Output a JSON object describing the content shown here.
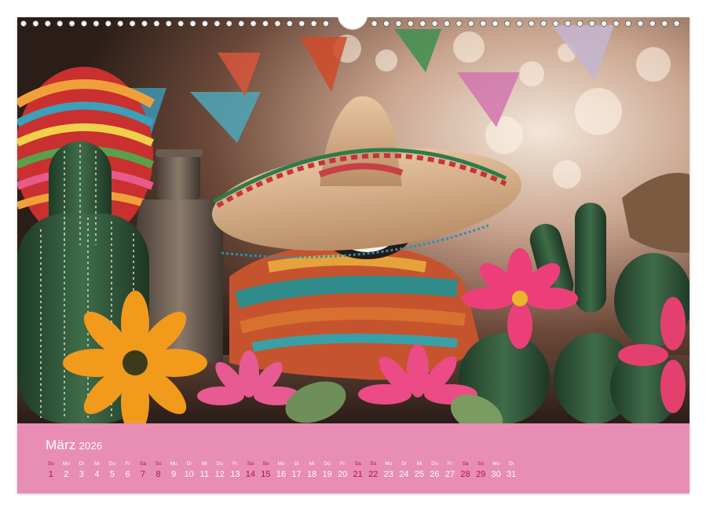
{
  "calendar": {
    "month": "März",
    "year": "2026",
    "days": [
      {
        "dow": "So",
        "num": "1",
        "weekend": true
      },
      {
        "dow": "Mo",
        "num": "2",
        "weekend": false
      },
      {
        "dow": "Di",
        "num": "3",
        "weekend": false
      },
      {
        "dow": "Mi",
        "num": "4",
        "weekend": false
      },
      {
        "dow": "Do",
        "num": "5",
        "weekend": false
      },
      {
        "dow": "Fr",
        "num": "6",
        "weekend": false
      },
      {
        "dow": "Sa",
        "num": "7",
        "weekend": true
      },
      {
        "dow": "So",
        "num": "8",
        "weekend": true
      },
      {
        "dow": "Mo",
        "num": "9",
        "weekend": false
      },
      {
        "dow": "Di",
        "num": "10",
        "weekend": false
      },
      {
        "dow": "Mi",
        "num": "11",
        "weekend": false
      },
      {
        "dow": "Do",
        "num": "12",
        "weekend": false
      },
      {
        "dow": "Fr",
        "num": "13",
        "weekend": false
      },
      {
        "dow": "Sa",
        "num": "14",
        "weekend": true
      },
      {
        "dow": "So",
        "num": "15",
        "weekend": true
      },
      {
        "dow": "Mo",
        "num": "16",
        "weekend": false
      },
      {
        "dow": "Di",
        "num": "17",
        "weekend": false
      },
      {
        "dow": "Mi",
        "num": "18",
        "weekend": false
      },
      {
        "dow": "Do",
        "num": "19",
        "weekend": false
      },
      {
        "dow": "Fr",
        "num": "20",
        "weekend": false
      },
      {
        "dow": "Sa",
        "num": "21",
        "weekend": true
      },
      {
        "dow": "So",
        "num": "22",
        "weekend": true
      },
      {
        "dow": "Mo",
        "num": "23",
        "weekend": false
      },
      {
        "dow": "Di",
        "num": "24",
        "weekend": false
      },
      {
        "dow": "Mi",
        "num": "25",
        "weekend": false
      },
      {
        "dow": "Do",
        "num": "26",
        "weekend": false
      },
      {
        "dow": "Fr",
        "num": "27",
        "weekend": false
      },
      {
        "dow": "Sa",
        "num": "28",
        "weekend": true
      },
      {
        "dow": "So",
        "num": "29",
        "weekend": true
      },
      {
        "dow": "Mo",
        "num": "30",
        "weekend": false
      },
      {
        "dow": "Di",
        "num": "31",
        "weekend": false
      }
    ]
  },
  "colors": {
    "band": "#e88db4",
    "weekend_text": "#b3153e",
    "weekday_text": "#ffffff"
  },
  "photo": {
    "subject_icons": [
      "calavera-figure-icon",
      "sombrero-icon",
      "cactus-icon",
      "flower-icon",
      "bottle-icon"
    ]
  }
}
